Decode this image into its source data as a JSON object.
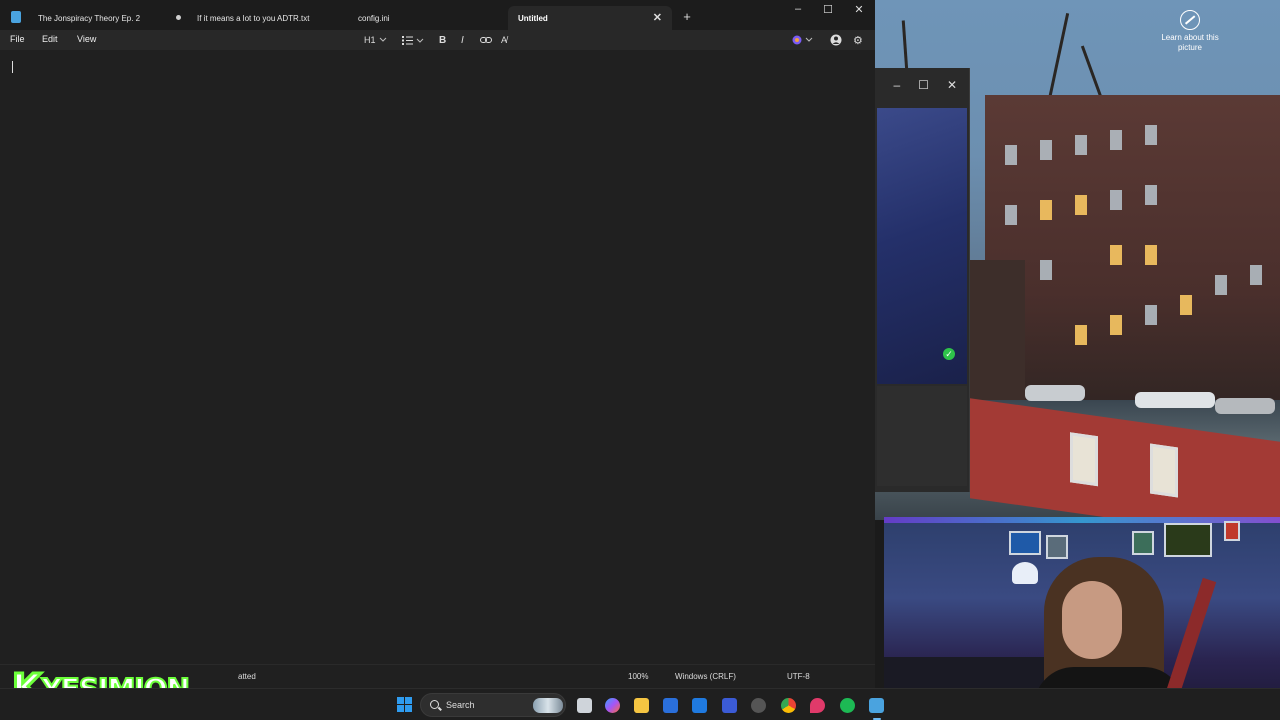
{
  "notepad": {
    "tabs": [
      {
        "label": "The Jonspiracy Theory Ep. 2",
        "active": false,
        "unsaved": false
      },
      {
        "label": "If it means a lot to you ADTR.txt",
        "active": false,
        "unsaved": true
      },
      {
        "label": "config.ini",
        "active": false,
        "unsaved": false
      },
      {
        "label": "Untitled",
        "active": true,
        "unsaved": false
      }
    ],
    "menus": {
      "file": "File",
      "edit": "Edit",
      "view": "View"
    },
    "toolbar": {
      "heading": "H1"
    },
    "status": {
      "format": "atted",
      "zoom": "100%",
      "line_ending": "Windows (CRLF)",
      "encoding": "UTF-8"
    },
    "content": ""
  },
  "desktop": {
    "learn_about": "Learn about this picture"
  },
  "overlay": {
    "logo_k": "K",
    "logo_rest": "YESIMJON"
  },
  "taskbar": {
    "search_label": "Search",
    "accent": "#2f9cf0"
  }
}
